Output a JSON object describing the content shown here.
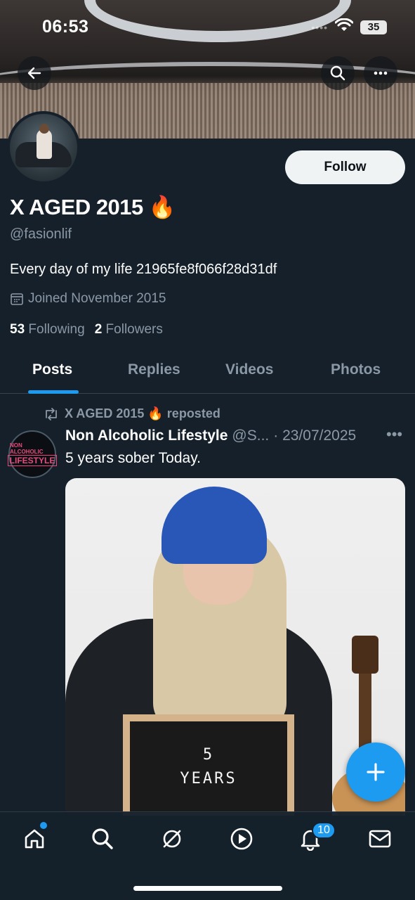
{
  "status_bar": {
    "time": "06:53",
    "battery": "35"
  },
  "profile": {
    "display_name": "X AGED 2015 🔥",
    "handle": "@fasionlif",
    "bio": "Every day of my life 21965fe8f066f28d31df",
    "joined": "Joined November 2015",
    "following_count": "53",
    "following_label": "Following",
    "followers_count": "2",
    "followers_label": "Followers",
    "follow_button": "Follow"
  },
  "tabs": [
    {
      "label": "Posts",
      "active": true
    },
    {
      "label": "Replies",
      "active": false
    },
    {
      "label": "Videos",
      "active": false
    },
    {
      "label": "Photos",
      "active": false
    }
  ],
  "post": {
    "repost_label": "X AGED 2015 🔥 reposted",
    "author_name": "Non Alcoholic Lifestyle",
    "author_handle": "@S...",
    "date": "· 23/07/2025",
    "text": "5 years sober Today.",
    "avatar_line1": "NON ALCOHOLIC",
    "avatar_line2": "LIFESTYLE",
    "board_line1": "5",
    "board_line2": "YEARS"
  },
  "bottom_nav": {
    "items": [
      "home-icon",
      "search-icon",
      "grok-icon",
      "video-icon",
      "notifications-icon",
      "messages-icon"
    ],
    "notification_badge": "10"
  },
  "colors": {
    "background": "#15202b",
    "accent": "#1d9bf0",
    "muted": "#8b98a5"
  }
}
